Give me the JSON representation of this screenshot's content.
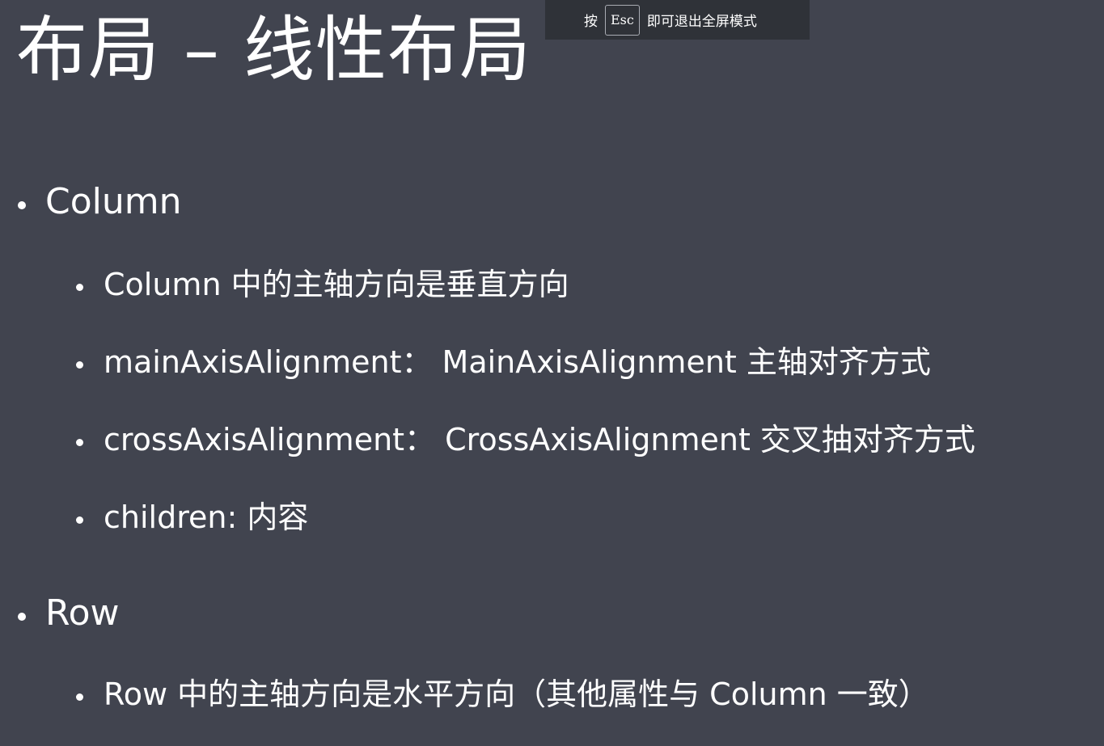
{
  "slide": {
    "title": "布局 – 线性布局",
    "bullets": [
      {
        "text": "Column",
        "children": [
          "Column 中的主轴方向是垂直方向",
          "mainAxisAlignment： MainAxisAlignment 主轴对齐方式",
          "crossAxisAlignment： CrossAxisAlignment 交叉抽对齐方式",
          "children: 内容"
        ]
      },
      {
        "text": "Row",
        "children": [
          "Row 中的主轴方向是水平方向（其他属性与 Column 一致）"
        ]
      }
    ]
  },
  "fullscreen_hint": {
    "prefix": "按",
    "key": "Esc",
    "suffix": "即可退出全屏模式"
  },
  "colors": {
    "background": "#41444f",
    "text": "#ffffff",
    "hint_background": "#2f3238"
  }
}
